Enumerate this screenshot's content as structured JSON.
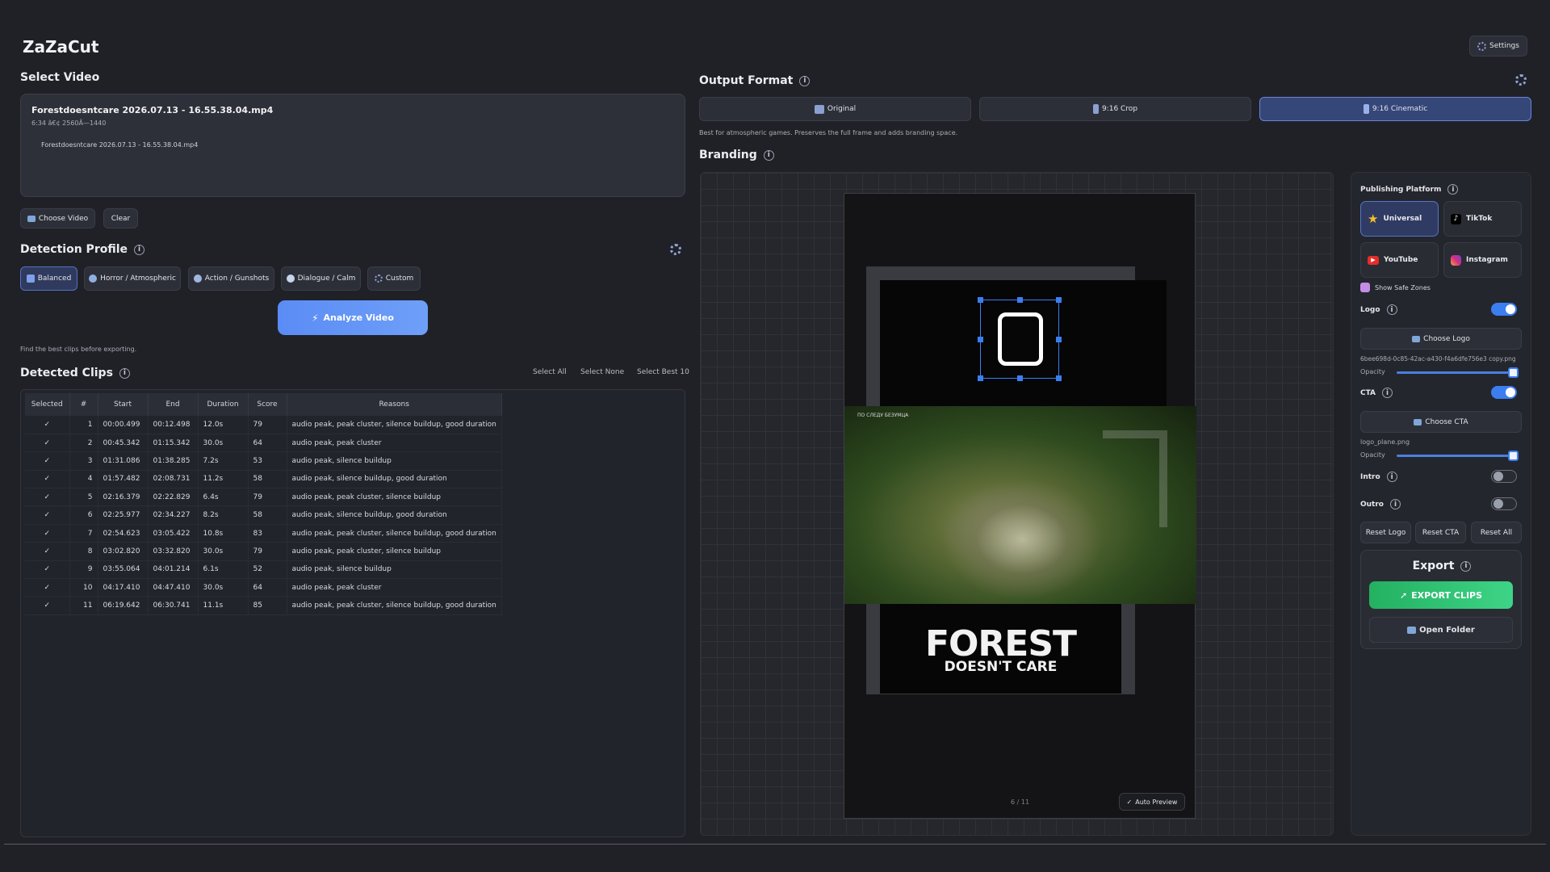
{
  "app": {
    "title": "ZaZaCut",
    "settings_label": "Settings"
  },
  "select_video": {
    "heading": "Select Video",
    "file_name": "Forestdoesntcare 2026.07.13 - 16.55.38.04.mp4",
    "file_meta": "6:34 â€¢ 2560Ã—1440",
    "file_item": "Forestdoesntcare 2026.07.13 - 16.55.38.04.mp4",
    "choose_label": "Choose Video",
    "clear_label": "Clear"
  },
  "detection": {
    "heading": "Detection Profile",
    "profiles": [
      {
        "label": "Balanced",
        "icon": "bar-chart-icon"
      },
      {
        "label": "Horror / Atmospheric",
        "icon": "ghost-icon"
      },
      {
        "label": "Action / Gunshots",
        "icon": "burst-icon"
      },
      {
        "label": "Dialogue / Calm",
        "icon": "speech-bubble-icon"
      },
      {
        "label": "Custom",
        "icon": "gear-icon"
      }
    ],
    "analyze_label": "Analyze Video",
    "hint": "Find the best clips before exporting."
  },
  "clips": {
    "heading": "Detected Clips",
    "select_all": "Select All",
    "select_none": "Select None",
    "select_best": "Select Best 10",
    "columns": [
      "Selected",
      "#",
      "Start",
      "End",
      "Duration",
      "Score",
      "Reasons"
    ],
    "rows": [
      {
        "sel": "✓",
        "n": "1",
        "start": "00:00.499",
        "end": "00:12.498",
        "dur": "12.0s",
        "score": "79",
        "reasons": "audio peak, peak cluster, silence buildup, good duration"
      },
      {
        "sel": "✓",
        "n": "2",
        "start": "00:45.342",
        "end": "01:15.342",
        "dur": "30.0s",
        "score": "64",
        "reasons": "audio peak, peak cluster"
      },
      {
        "sel": "✓",
        "n": "3",
        "start": "01:31.086",
        "end": "01:38.285",
        "dur": "7.2s",
        "score": "53",
        "reasons": "audio peak, silence buildup"
      },
      {
        "sel": "✓",
        "n": "4",
        "start": "01:57.482",
        "end": "02:08.731",
        "dur": "11.2s",
        "score": "58",
        "reasons": "audio peak, silence buildup, good duration"
      },
      {
        "sel": "✓",
        "n": "5",
        "start": "02:16.379",
        "end": "02:22.829",
        "dur": "6.4s",
        "score": "79",
        "reasons": "audio peak, peak cluster, silence buildup"
      },
      {
        "sel": "✓",
        "n": "6",
        "start": "02:25.977",
        "end": "02:34.227",
        "dur": "8.2s",
        "score": "58",
        "reasons": "audio peak, silence buildup, good duration"
      },
      {
        "sel": "✓",
        "n": "7",
        "start": "02:54.623",
        "end": "03:05.422",
        "dur": "10.8s",
        "score": "83",
        "reasons": "audio peak, peak cluster, silence buildup, good duration"
      },
      {
        "sel": "✓",
        "n": "8",
        "start": "03:02.820",
        "end": "03:32.820",
        "dur": "30.0s",
        "score": "79",
        "reasons": "audio peak, peak cluster, silence buildup"
      },
      {
        "sel": "✓",
        "n": "9",
        "start": "03:55.064",
        "end": "04:01.214",
        "dur": "6.1s",
        "score": "52",
        "reasons": "audio peak, silence buildup"
      },
      {
        "sel": "✓",
        "n": "10",
        "start": "04:17.410",
        "end": "04:47.410",
        "dur": "30.0s",
        "score": "64",
        "reasons": "audio peak, peak cluster"
      },
      {
        "sel": "✓",
        "n": "11",
        "start": "06:19.642",
        "end": "06:30.741",
        "dur": "11.1s",
        "score": "85",
        "reasons": "audio peak, peak cluster, silence buildup, good duration"
      }
    ]
  },
  "output": {
    "heading": "Output Format",
    "formats": [
      "Original",
      "9:16 Crop",
      "9:16 Cinematic"
    ],
    "selected": "9:16 Cinematic",
    "description": "Best for atmospheric games. Preserves the full frame and adds branding space."
  },
  "branding": {
    "heading": "Branding",
    "game_title_line1": "FOREST",
    "game_title_line2": "DOESN'T CARE",
    "video_overlay_text": "ПО СЛЕДУ БЕЗУМЦА",
    "page_indicator": "6 / 11",
    "auto_preview_label": "Auto Preview"
  },
  "side": {
    "platform_heading": "Publishing Platform",
    "platforms": [
      "Universal",
      "TikTok",
      "YouTube",
      "Instagram"
    ],
    "show_safe_zones": "Show Safe Zones",
    "logo_label": "Logo",
    "choose_logo": "Choose Logo",
    "logo_file": "6bee698d-0c85-42ac-a430-f4a6dfe756e3 copy.png",
    "opacity_label": "Opacity",
    "logo_opacity": 1.0,
    "cta_label": "CTA",
    "choose_cta": "Choose CTA",
    "cta_file": "logo_plane.png",
    "cta_opacity": 1.0,
    "intro_label": "Intro",
    "outro_label": "Outro",
    "reset_logo": "Reset Logo",
    "reset_cta": "Reset CTA",
    "reset_all": "Reset All",
    "export_heading": "Export",
    "export_clips": "EXPORT CLIPS",
    "open_folder": "Open Folder"
  },
  "colors": {
    "accent": "#3b7ef0",
    "export_green": "#2fbf71",
    "bg": "#202127"
  }
}
